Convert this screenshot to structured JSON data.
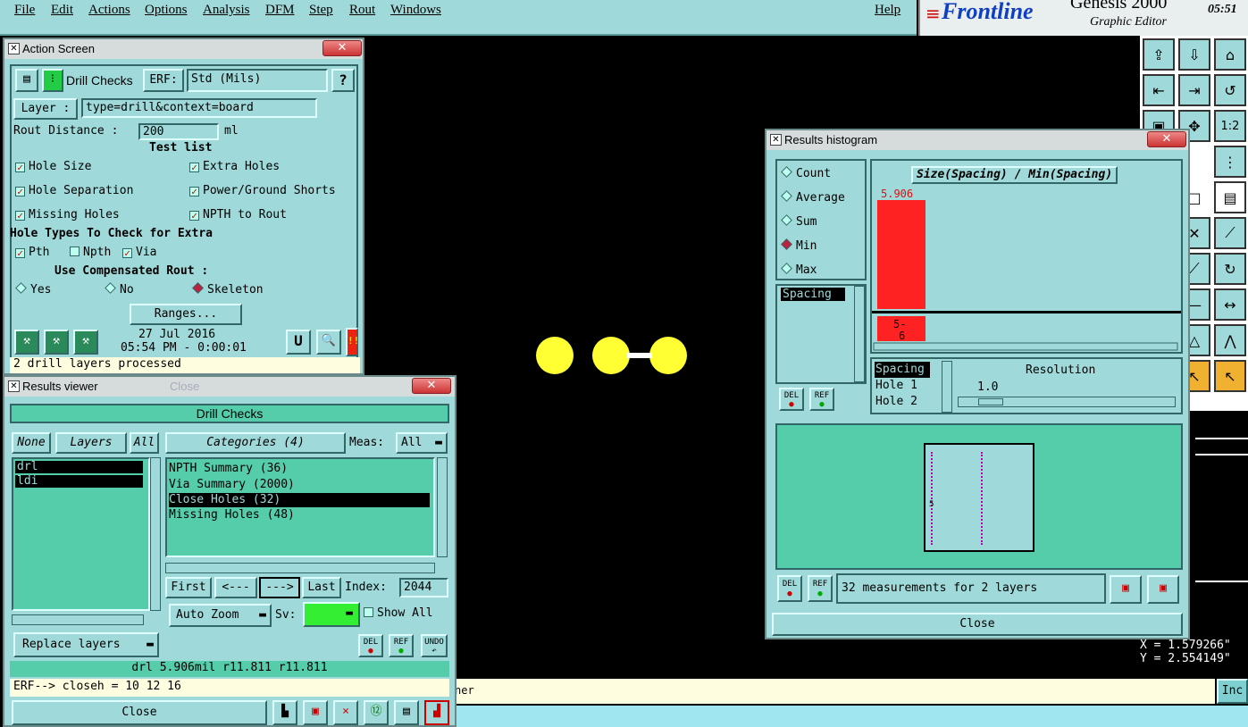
{
  "menu": {
    "items": [
      "File",
      "Edit",
      "Actions",
      "Options",
      "Analysis",
      "DFM",
      "Step",
      "Rout",
      "Windows"
    ],
    "help": "Help"
  },
  "brand": {
    "logo": "Frontline",
    "product": "Genesis 2000",
    "subtitle": "Graphic Editor",
    "clock": "05:51"
  },
  "action_screen": {
    "title": "Action Screen",
    "close": "✕",
    "check_name": "Drill Checks",
    "erf_label": "ERF:",
    "erf_value": "Std (Mils)",
    "help": "?",
    "layer_label": "Layer :",
    "layer_value": "type=drill&context=board",
    "rout_label": "Rout Distance :",
    "rout_value": "200",
    "rout_unit": "ml",
    "test_list": "Test list",
    "tests": [
      "Hole Size",
      "Extra Holes",
      "Hole Separation",
      "Power/Ground Shorts",
      "Missing Holes",
      "NPTH to Rout"
    ],
    "hole_types_label": "Hole Types To Check for Extra",
    "hole_types": [
      "Pth",
      "Npth",
      "Via"
    ],
    "comp_label": "Use Compensated Rout :",
    "comp_options": [
      "Yes",
      "No",
      "Skeleton"
    ],
    "ranges": "Ranges...",
    "date": "27 Jul 2016",
    "time": "05:54 PM - 0:00:01",
    "status": "2 drill layers processed",
    "u_btn": "U",
    "stop_btn": "!!"
  },
  "results_viewer": {
    "title": "Results viewer",
    "close": "✕",
    "ghost_title": "Close",
    "header": "Drill Checks",
    "none": "None",
    "layers": "Layers",
    "all": "All",
    "categories": "Categories (4)",
    "meas_label": "Meas:",
    "meas_value": "All",
    "layer_items": [
      "drl",
      "ldi"
    ],
    "category_items": [
      "NPTH Summary (36)",
      "Via Summary (2000)",
      "Close Holes (32)",
      "Missing Holes (48)"
    ],
    "first": "First",
    "prev": "<---",
    "next": "--->",
    "last": "Last",
    "index_label": "Index:",
    "index_value": "2044",
    "auto_zoom": "Auto Zoom",
    "sv_label": "Sv:",
    "show_all": "Show All",
    "replace_layers": "Replace layers",
    "del": "DEL",
    "ref": "REF",
    "undo": "UNDO",
    "info": "drl 5.906mil  r11.811  r11.811",
    "erf_line": "ERF--> closeh = 10 12 16",
    "close_btn": "Close"
  },
  "histogram": {
    "title": "Results histogram",
    "close": "✕",
    "modes": [
      "Count",
      "Average",
      "Sum",
      "Min",
      "Max"
    ],
    "selected_mode": "Min",
    "measure_items": [
      "Spacing"
    ],
    "chart_title": "Size(Spacing) / Min(Spacing)",
    "bar_value_label": "5.906",
    "bin_label": "5-\n6",
    "fields": [
      "Spacing",
      "Hole 1",
      "Hole 2"
    ],
    "resolution_label": "Resolution",
    "resolution_value": "1.0",
    "preview_label": "5",
    "del": "DEL",
    "ref": "REF",
    "status": "32 measurements for 2 layers",
    "close_btn": "Close"
  },
  "canvas": {
    "coord_x": "X = 1.579266\"",
    "coord_y": "Y = 2.554149\"",
    "bottom_msg": "ner",
    "inc_btn": "Inc"
  },
  "colors": {
    "teal_panel": "#9fd9d9",
    "list_green": "#55ccaa",
    "hole_yellow": "#ffff33",
    "bar_red": "#ff2222"
  },
  "chart_data": {
    "type": "bar",
    "title": "Size(Spacing) / Min(Spacing)",
    "categories": [
      "5-\n6"
    ],
    "values": [
      5.906
    ]
  }
}
